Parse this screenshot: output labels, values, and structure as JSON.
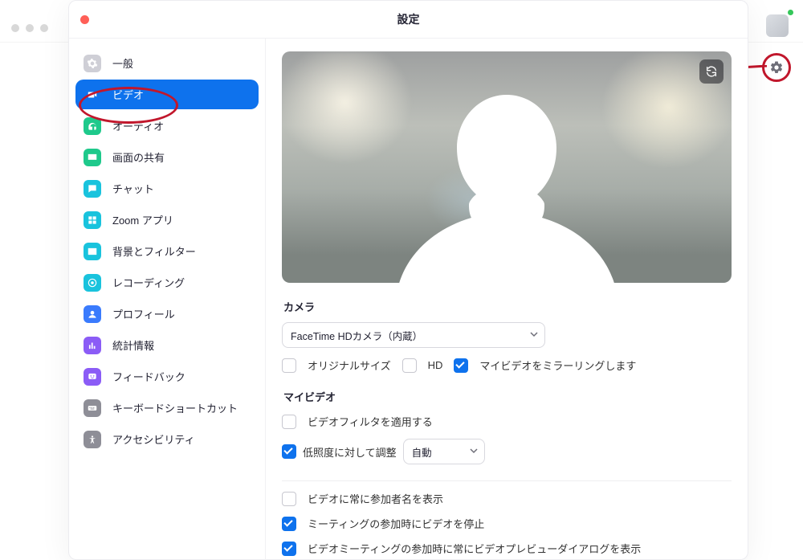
{
  "window": {
    "title": "設定"
  },
  "sidebar": {
    "items": [
      {
        "label": "一般",
        "icon": "gear-icon",
        "iconBg": "#cfcfd6"
      },
      {
        "label": "ビデオ",
        "icon": "video-icon",
        "iconBg": "#0e72ed",
        "active": true
      },
      {
        "label": "オーディオ",
        "icon": "headphones-icon",
        "iconBg": "#1ec98b"
      },
      {
        "label": "画面の共有",
        "icon": "share-screen-icon",
        "iconBg": "#1ec98b"
      },
      {
        "label": "チャット",
        "icon": "chat-icon",
        "iconBg": "#19c3dd"
      },
      {
        "label": "Zoom アプリ",
        "icon": "apps-icon",
        "iconBg": "#19c3dd"
      },
      {
        "label": "背景とフィルター",
        "icon": "background-icon",
        "iconBg": "#19c3dd"
      },
      {
        "label": "レコーディング",
        "icon": "record-icon",
        "iconBg": "#19c3dd"
      },
      {
        "label": "プロフィール",
        "icon": "profile-icon",
        "iconBg": "#3a7bfd"
      },
      {
        "label": "統計情報",
        "icon": "stats-icon",
        "iconBg": "#8b5cf6"
      },
      {
        "label": "フィードバック",
        "icon": "feedback-icon",
        "iconBg": "#8b5cf6"
      },
      {
        "label": "キーボードショートカット",
        "icon": "keyboard-icon",
        "iconBg": "#8e8e97"
      },
      {
        "label": "アクセシビリティ",
        "icon": "accessibility-icon",
        "iconBg": "#8e8e97"
      }
    ]
  },
  "video": {
    "cameraLabel": "カメラ",
    "cameraSelected": "FaceTime HDカメラ（内蔵）",
    "options": {
      "originalSize": {
        "label": "オリジナルサイズ",
        "checked": false
      },
      "hd": {
        "label": "HD",
        "checked": false
      },
      "mirror": {
        "label": "マイビデオをミラーリングします",
        "checked": true
      }
    },
    "myVideoLabel": "マイビデオ",
    "filter": {
      "label": "ビデオフィルタを適用する",
      "checked": false
    },
    "lowLight": {
      "label": "低照度に対して調整",
      "checked": true,
      "modeSelected": "自動"
    },
    "displayName": {
      "label": "ビデオに常に参加者名を表示",
      "checked": false
    },
    "stopOnJoin": {
      "label": "ミーティングの参加時にビデオを停止",
      "checked": true
    },
    "previewDialog": {
      "label": "ビデオミーティングの参加時に常にビデオプレビューダイアログを表示",
      "checked": true
    }
  }
}
